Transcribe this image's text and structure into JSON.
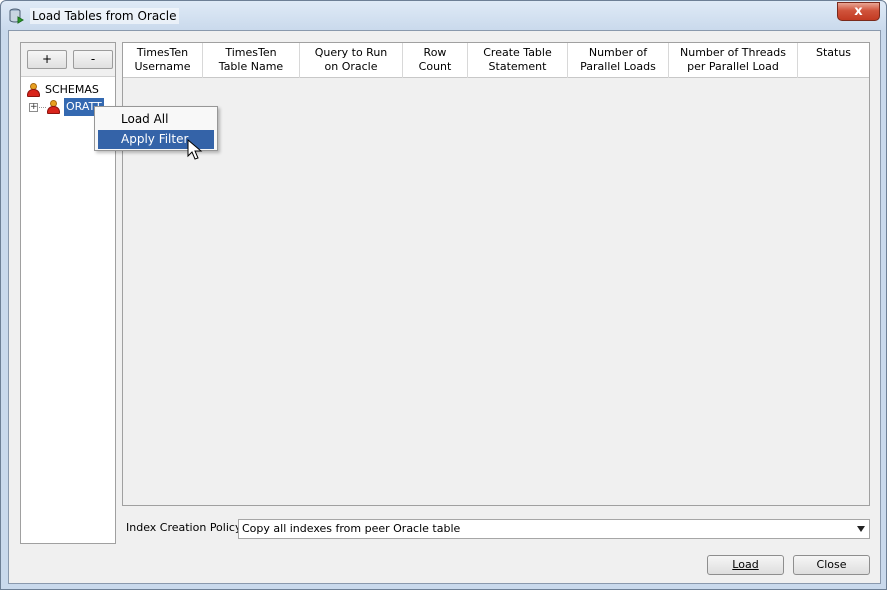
{
  "window": {
    "title": "Load Tables from Oracle",
    "close_glyph": "x"
  },
  "left_panel": {
    "add_label": "+",
    "remove_label": "-",
    "tree": {
      "root_label": "SCHEMAS",
      "child_label": "ORATT",
      "expander_glyph": "+"
    }
  },
  "table": {
    "columns": [
      "TimesTen\nUsername",
      "TimesTen\nTable Name",
      "Query to Run\non Oracle",
      "Row\nCount",
      "Create Table\nStatement",
      "Number of\nParallel Loads",
      "Number of Threads\nper Parallel Load",
      "Status"
    ],
    "rows": []
  },
  "index_policy": {
    "label": "Index Creation Policy:",
    "selected": "Copy all indexes from peer Oracle table"
  },
  "buttons": {
    "load": "Load",
    "close": "Close"
  },
  "context_menu": {
    "items": [
      "Load All",
      "Apply Filter"
    ],
    "highlighted": "Apply Filter"
  },
  "colors": {
    "selection": "#3469b1",
    "menu_highlight": "#3463a8",
    "close_button": "#c23a22"
  }
}
